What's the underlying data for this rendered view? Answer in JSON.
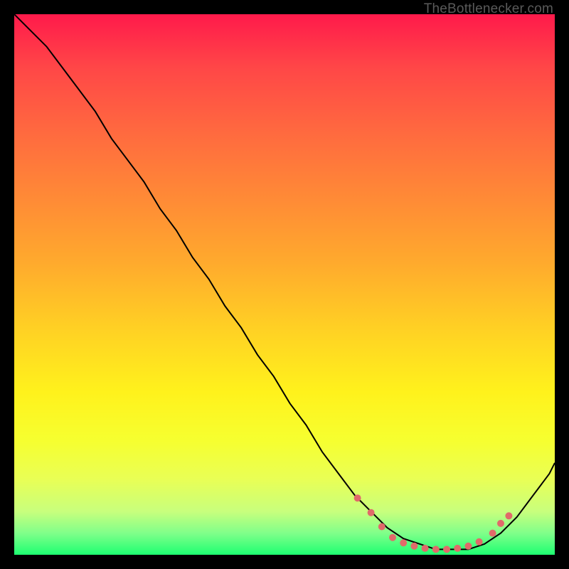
{
  "watermark": "TheBottlenecker.com",
  "chart_data": {
    "type": "line",
    "title": "",
    "xlabel": "",
    "ylabel": "",
    "xlim": [
      0,
      100
    ],
    "ylim": [
      0,
      100
    ],
    "grid": false,
    "legend": false,
    "series": [
      {
        "name": "curve",
        "x": [
          0,
          3,
          6,
          9,
          12,
          15,
          18,
          21,
          24,
          27,
          30,
          33,
          36,
          39,
          42,
          45,
          48,
          51,
          54,
          57,
          60,
          63,
          66,
          69,
          72,
          75,
          78,
          81,
          84,
          87,
          90,
          93,
          96,
          99,
          100
        ],
        "y": [
          100,
          97,
          94,
          90,
          86,
          82,
          77,
          73,
          69,
          64,
          60,
          55,
          51,
          46,
          42,
          37,
          33,
          28,
          24,
          19,
          15,
          11,
          8,
          5,
          3,
          2,
          1,
          1,
          1,
          2,
          4,
          7,
          11,
          15,
          17
        ],
        "stroke": "#000000",
        "stroke_width": 2
      }
    ],
    "markers": {
      "name": "dots",
      "color": "#e06a6a",
      "radius": 5,
      "points_x": [
        63.5,
        66,
        68,
        70,
        72,
        74,
        76,
        78,
        80,
        82,
        84,
        86,
        88.5,
        90,
        91.5
      ],
      "points_y": [
        10.5,
        7.8,
        5.2,
        3.2,
        2.2,
        1.6,
        1.2,
        1.0,
        1.0,
        1.2,
        1.6,
        2.4,
        4.0,
        5.8,
        7.2
      ]
    }
  }
}
